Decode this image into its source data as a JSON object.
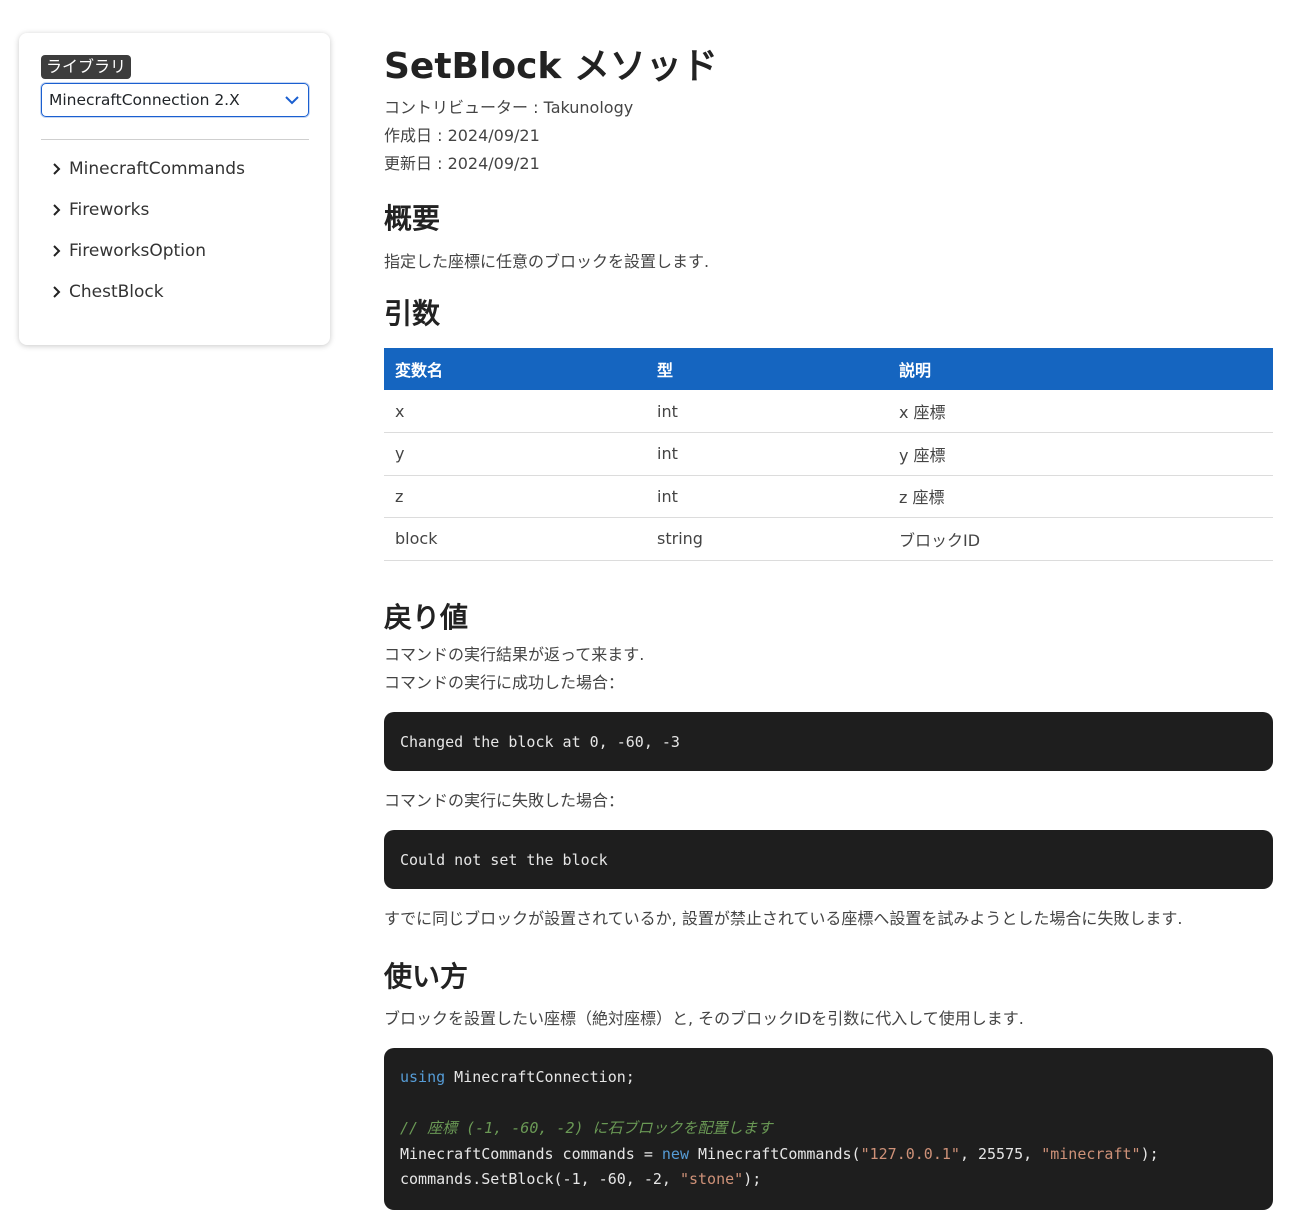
{
  "sidebar": {
    "library_badge": "ライブラリ",
    "selected_library": "MinecraftConnection 2.X",
    "items": [
      {
        "label": "MinecraftCommands"
      },
      {
        "label": "Fireworks"
      },
      {
        "label": "FireworksOption"
      },
      {
        "label": "ChestBlock"
      }
    ]
  },
  "page": {
    "title": "SetBlock メソッド",
    "contributor": "コントリビューター : Takunology",
    "created": "作成日 : 2024/09/21",
    "updated": "更新日 : 2024/09/21"
  },
  "overview": {
    "heading": "概要",
    "text": "指定した座標に任意のブロックを設置します."
  },
  "args": {
    "heading": "引数",
    "columns": [
      "変数名",
      "型",
      "説明"
    ],
    "rows": [
      [
        "x",
        "int",
        "x 座標"
      ],
      [
        "y",
        "int",
        "y 座標"
      ],
      [
        "z",
        "int",
        "z 座標"
      ],
      [
        "block",
        "string",
        "ブロックID"
      ]
    ]
  },
  "returns": {
    "heading": "戻り値",
    "line1": "コマンドの実行結果が返って来ます.",
    "line2": "コマンドの実行に成功した場合：",
    "success_code": "Changed the block at 0, -60, -3",
    "fail_label": "コマンドの実行に失敗した場合：",
    "fail_code": "Could not set the block",
    "note": "すでに同じブロックが設置されているか, 設置が禁止されている座標へ設置を試みようとした場合に失敗します."
  },
  "usage": {
    "heading": "使い方",
    "text": "ブロックを設置したい座標（絶対座標）と, そのブロックIDを引数に代入して使用します.",
    "code": {
      "l1_kw": "using",
      "l1_rest": " MinecraftConnection;",
      "l3_comment": "// 座標 (-1, -60, -2) に石ブロックを配置します",
      "l4_a": "MinecraftCommands commands = ",
      "l4_kw": "new",
      "l4_b": " MinecraftCommands(",
      "l4_s1": "\"127.0.0.1\"",
      "l4_c": ", 25575, ",
      "l4_s2": "\"minecraft\"",
      "l4_d": ");",
      "l5_a": "commands.SetBlock(-1, -60, -2, ",
      "l5_s": "\"stone\"",
      "l5_b": ");"
    }
  }
}
